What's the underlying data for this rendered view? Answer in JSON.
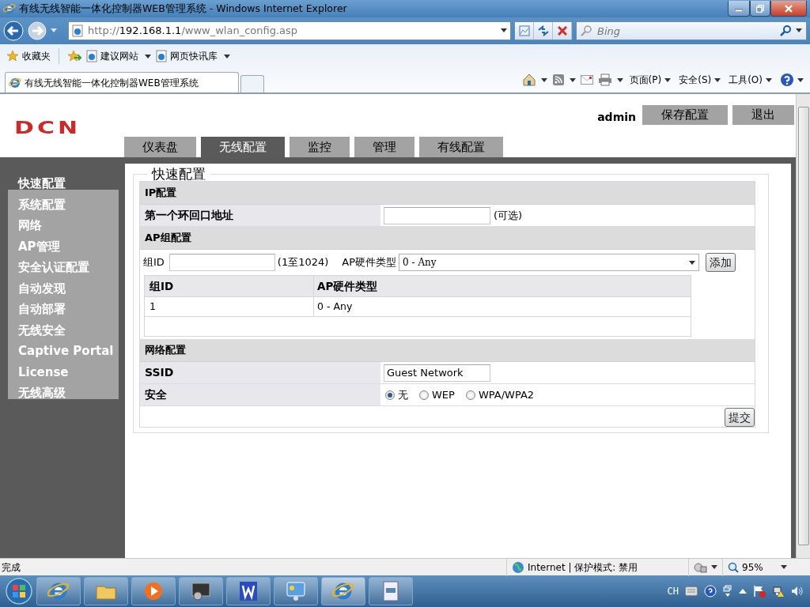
{
  "window": {
    "title": "有线无线智能一体化控制器WEB管理系统 - Windows Internet Explorer"
  },
  "address_bar": {
    "scheme": "http://",
    "host": "192.168.1.1",
    "path": "/www_wlan_config.asp"
  },
  "search": {
    "placeholder": "Bing"
  },
  "favorites_bar": {
    "favorites_label": "收藏夹",
    "links": [
      {
        "label": "建议网站"
      },
      {
        "label": "网页快讯库"
      }
    ]
  },
  "browser_tabs": [
    {
      "label": "有线无线智能一体化控制器WEB管理系统",
      "selected": true
    }
  ],
  "command_bar": {
    "menus": [
      "页面(P)",
      "安全(S)",
      "工具(O)"
    ]
  },
  "page": {
    "logo": "DCN",
    "user": "admin",
    "header_buttons": [
      "保存配置",
      "退出"
    ],
    "nav_tabs": [
      {
        "label": "仪表盘",
        "selected": false
      },
      {
        "label": "无线配置",
        "selected": true
      },
      {
        "label": "监控",
        "selected": false
      },
      {
        "label": "管理",
        "selected": false
      },
      {
        "label": "有线配置",
        "selected": false
      }
    ],
    "sidebar": [
      {
        "label": "快速配置",
        "selected": true
      },
      {
        "label": "系统配置",
        "selected": false
      },
      {
        "label": "网络",
        "selected": false
      },
      {
        "label": "AP管理",
        "selected": false
      },
      {
        "label": "安全认证配置",
        "selected": false
      },
      {
        "label": "自动发现",
        "selected": false
      },
      {
        "label": "自动部署",
        "selected": false
      },
      {
        "label": "无线安全",
        "selected": false
      },
      {
        "label": "Captive Portal",
        "selected": false
      },
      {
        "label": "License",
        "selected": false
      },
      {
        "label": "无线高级",
        "selected": false
      }
    ],
    "panel_title": "快速配置",
    "sections": [
      {
        "title": "IP配置",
        "rows": [
          {
            "kind": "input",
            "label": "第一个环回口地址",
            "note": "(可选)"
          }
        ]
      },
      {
        "title": "AP组配置",
        "group_form": {
          "id_label": "组ID",
          "id_range": "(1至1024)",
          "type_label": "AP硬件类型",
          "type_value": "0 - Any",
          "add_button": "添加"
        },
        "table": {
          "columns": [
            "组ID",
            "AP硬件类型"
          ],
          "rows": [
            [
              "1",
              "0 - Any"
            ]
          ]
        }
      },
      {
        "title": "网络配置",
        "rows": [
          {
            "kind": "input",
            "label": "SSID",
            "value": "Guest Network"
          },
          {
            "kind": "radio",
            "label": "安全",
            "options": [
              {
                "label": "无",
                "selected": true
              },
              {
                "label": "WEP",
                "selected": false
              },
              {
                "label": "WPA/WPA2",
                "selected": false
              }
            ]
          }
        ]
      }
    ],
    "submit_button": "提交"
  },
  "status_bar": {
    "text": "完成",
    "zone": "Internet | 保护模式: 禁用",
    "zoom": "95%"
  },
  "taskbar": {
    "language": "CH"
  }
}
